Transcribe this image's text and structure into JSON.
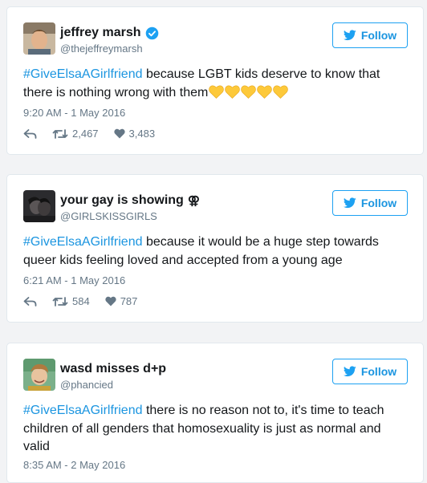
{
  "colors": {
    "link": "#1b95e0",
    "follow_border": "#1da1f2",
    "muted": "#657786",
    "verified": "#1da1f2",
    "heart_emoji": "#fdc93a"
  },
  "tweets": [
    {
      "name": "jeffrey marsh",
      "handle": "@thejeffreymarsh",
      "verified": true,
      "follow_label": "Follow",
      "hashtag": "#GiveElsaAGirlfriend",
      "text": "because LGBT kids deserve to know that there is nothing wrong with them",
      "emoji_icon": "yellow-heart-emoji",
      "emoji_count": 5,
      "timestamp": "9:20 AM - 1 May 2016",
      "retweets": "2,467",
      "likes": "3,483"
    },
    {
      "name": "your gay is showing",
      "name_symbol": "⚢",
      "handle": "@GIRLSKISSGIRLS",
      "follow_label": "Follow",
      "hashtag": "#GiveElsaAGirlfriend",
      "text": "because it would be a huge step towards queer kids feeling loved and accepted from a young age",
      "timestamp": "6:21 AM - 1 May 2016",
      "retweets": "584",
      "likes": "787"
    },
    {
      "name": "wasd misses d+p",
      "handle": "@phancied",
      "follow_label": "Follow",
      "hashtag": "#GiveElsaAGirlfriend",
      "text": "there is no reason not to, it's time to teach children of all genders that homosexuality is just as normal and valid",
      "timestamp": "8:35 AM - 2 May 2016"
    }
  ]
}
